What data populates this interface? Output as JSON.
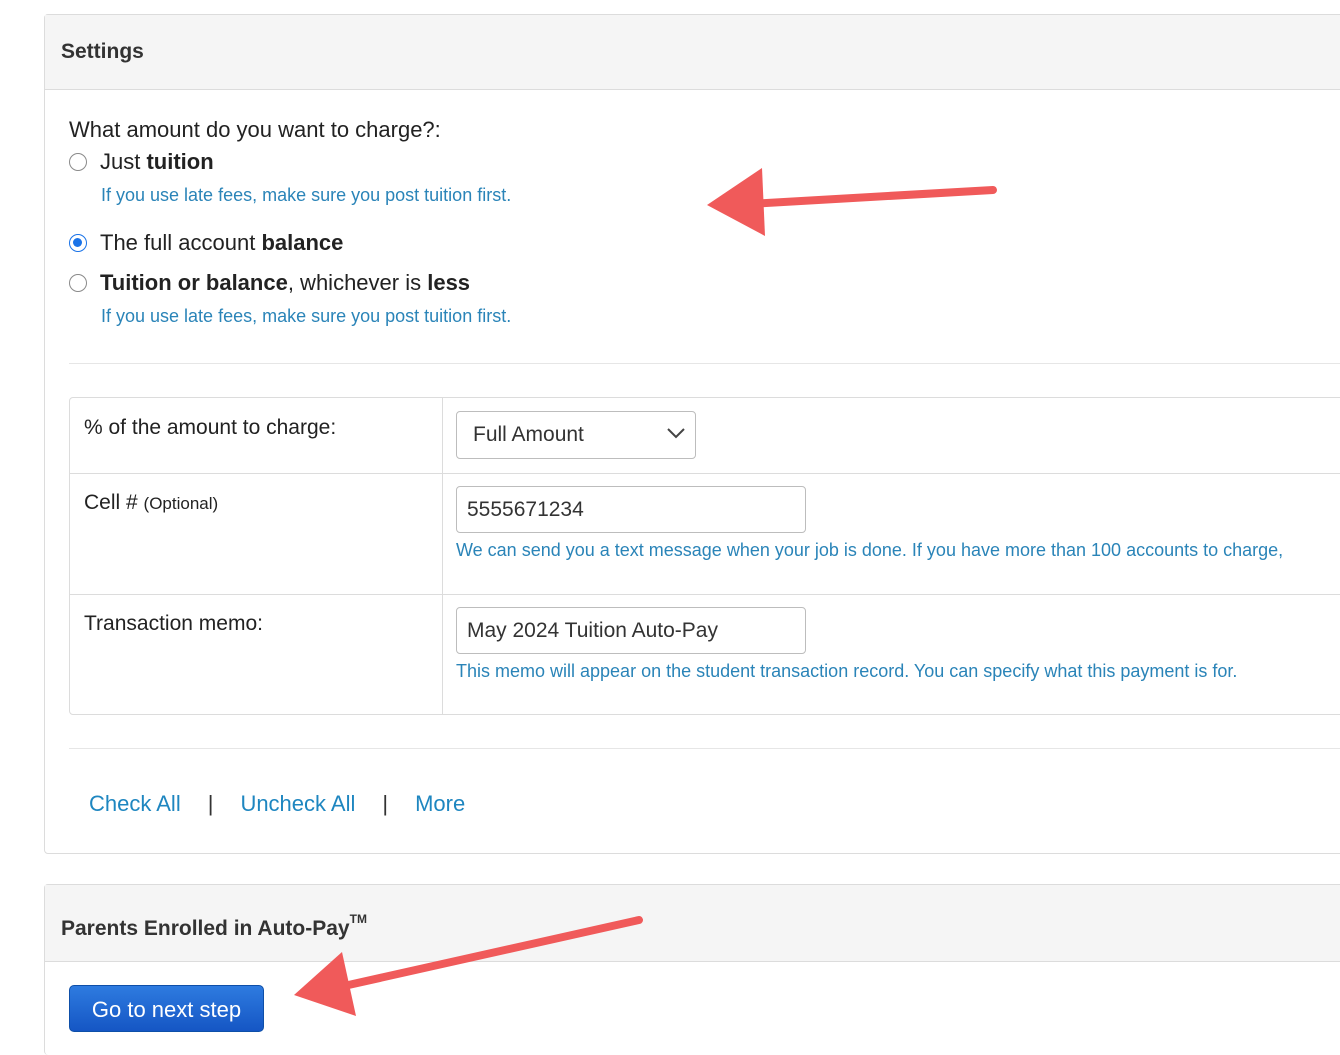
{
  "settings": {
    "heading": "Settings",
    "question": "What amount do you want to charge?:",
    "options": [
      {
        "pre": "Just ",
        "bold": "tuition",
        "mid": "",
        "bold2": "",
        "selected": false
      },
      {
        "pre": "The full account ",
        "bold": "balance",
        "mid": "",
        "bold2": "",
        "selected": true
      },
      {
        "pre": "",
        "bold": "Tuition or balance",
        "mid": ", whichever is ",
        "bold2": "less",
        "selected": false
      }
    ],
    "option_help": "If you use late fees, make sure you post tuition first.",
    "percent_label": "% of the amount to charge:",
    "percent_value": "Full Amount",
    "cell_label": "Cell #",
    "cell_optional": "(Optional)",
    "cell_value": "5555671234",
    "cell_help": "We can send you a text message when your job is done. If you have more than 100 accounts to charge,",
    "memo_label": "Transaction memo:",
    "memo_value": "May 2024 Tuition Auto-Pay",
    "memo_help": "This memo will appear on the student transaction record. You can specify what this payment is for.",
    "links": {
      "check_all": "Check All",
      "uncheck_all": "Uncheck All",
      "more": "More",
      "separator": "|"
    }
  },
  "enrolled": {
    "heading": "Parents Enrolled in Auto-Pay",
    "tm": "TM",
    "next_button": "Go to next step"
  },
  "colors": {
    "link": "#1e86c0",
    "help": "#2a84b8",
    "button": "#1556c4",
    "annotation_arrow": "#f05a5a"
  }
}
